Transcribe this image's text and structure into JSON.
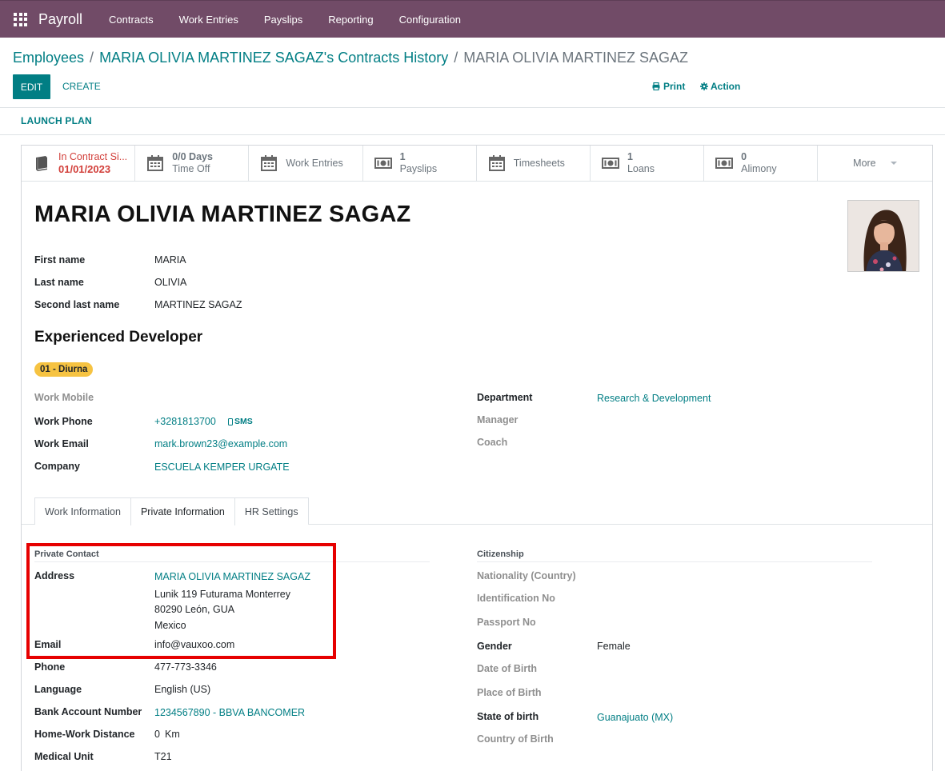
{
  "navbar": {
    "app_name": "Payroll",
    "menu": [
      "Contracts",
      "Work Entries",
      "Payslips",
      "Reporting",
      "Configuration"
    ]
  },
  "breadcrumb": {
    "items": [
      "Employees",
      "MARIA OLIVIA MARTINEZ SAGAZ's Contracts History"
    ],
    "current": "MARIA OLIVIA MARTINEZ SAGAZ"
  },
  "controls": {
    "edit": "EDIT",
    "create": "CREATE",
    "print": "Print",
    "action": "Action",
    "launch_plan": "LAUNCH PLAN"
  },
  "stats": {
    "contract": {
      "label": "In Contract Si...",
      "value": "01/01/2023"
    },
    "time_off": {
      "value": "0/0 Days",
      "label": "Time Off"
    },
    "work_entries": {
      "label": "Work Entries"
    },
    "payslips": {
      "value": "1",
      "label": "Payslips"
    },
    "timesheets": {
      "label": "Timesheets"
    },
    "loans": {
      "value": "1",
      "label": "Loans"
    },
    "alimony": {
      "value": "0",
      "label": "Alimony"
    },
    "more": "More"
  },
  "employee": {
    "full_name": "MARIA OLIVIA MARTINEZ SAGAZ",
    "first_name_label": "First name",
    "first_name": "MARIA",
    "last_name_label": "Last name",
    "last_name": "OLIVIA",
    "second_last_name_label": "Second last name",
    "second_last_name": "MARTINEZ SAGAZ",
    "job_title": "Experienced Developer",
    "tag": "01 - Diurna",
    "work_mobile_label": "Work Mobile",
    "work_phone_label": "Work Phone",
    "work_phone": "+3281813700",
    "sms": "SMS",
    "work_email_label": "Work Email",
    "work_email": "mark.brown23@example.com",
    "company_label": "Company",
    "company": "ESCUELA KEMPER URGATE",
    "department_label": "Department",
    "department": "Research & Development",
    "manager_label": "Manager",
    "coach_label": "Coach"
  },
  "tabs": [
    "Work Information",
    "Private Information",
    "HR Settings"
  ],
  "private_contact": {
    "section": "Private Contact",
    "address_label": "Address",
    "address_name": "MARIA OLIVIA MARTINEZ SAGAZ",
    "address_line1": "Lunik 119 Futurama Monterrey",
    "address_line2": "80290 León, GUA",
    "address_line3": "Mexico",
    "email_label": "Email",
    "email": "info@vauxoo.com",
    "phone_label": "Phone",
    "phone": "477-773-3346",
    "language_label": "Language",
    "language": "English (US)",
    "bank_label": "Bank Account Number",
    "bank": "1234567890 - BBVA BANCOMER",
    "distance_label": "Home-Work Distance",
    "distance": "0",
    "distance_unit": "Km",
    "medical_label": "Medical Unit",
    "medical": "T21"
  },
  "citizenship": {
    "section": "Citizenship",
    "nationality_label": "Nationality (Country)",
    "identification_label": "Identification No",
    "passport_label": "Passport No",
    "gender_label": "Gender",
    "gender": "Female",
    "dob_label": "Date of Birth",
    "pob_label": "Place of Birth",
    "state_label": "State of birth",
    "state": "Guanajuato (MX)",
    "country_birth_label": "Country of Birth"
  },
  "colors": {
    "navbar": "#714B67",
    "primary": "#017e84",
    "danger": "#d23f3a",
    "tag": "#f6c342",
    "highlight": "#e60000"
  }
}
